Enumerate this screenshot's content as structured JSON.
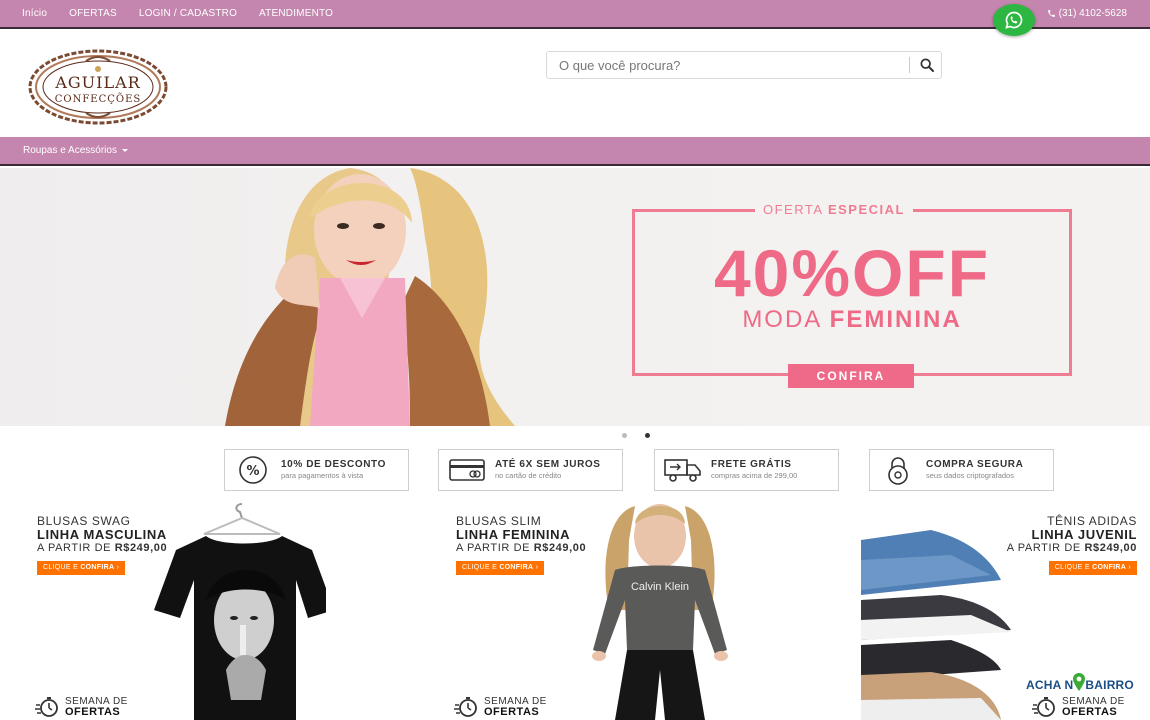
{
  "topbar": {
    "nav": [
      "Início",
      "OFERTAS",
      "LOGIN / CADASTRO",
      "ATENDIMENTO"
    ],
    "phone": "(31) 4102-5628",
    "phone_icon": "phone-icon",
    "whatsapp_icon": "whatsapp-icon"
  },
  "header": {
    "logo_line1": "AGUILAR",
    "logo_line2": "CONFECÇÕES",
    "search_placeholder": "O que você procura?",
    "search_icon": "search-icon"
  },
  "category_menu": {
    "label": "Roupas e Acessórios"
  },
  "banner": {
    "tag_light": "OFERTA",
    "tag_bold": "ESPECIAL",
    "headline": "40%OFF",
    "sub_light": "MODA",
    "sub_bold": "FEMININA",
    "cta": "CONFIRA",
    "slides_total": 2,
    "active_slide": 2
  },
  "features": [
    {
      "title": "10% DE DESCONTO",
      "subtitle": "para pagamentos à vista",
      "icon": "percent-icon"
    },
    {
      "title": "ATÉ 6X SEM JUROS",
      "subtitle": "no cartão de crédito",
      "icon": "credit-card-icon"
    },
    {
      "title": "FRETE GRÁTIS",
      "subtitle": "compras acima de 299,00",
      "icon": "truck-icon"
    },
    {
      "title": "COMPRA SEGURA",
      "subtitle": "seus dados criptografados",
      "icon": "lock-icon"
    }
  ],
  "products": [
    {
      "line1": "BLUSAS SWAG",
      "line2": "LINHA MASCULINA",
      "price_prefix": "A PARTIR DE",
      "price": "R$249,00",
      "cta_light": "CLIQUE E",
      "cta_bold": "CONFIRA",
      "week_line1": "SEMANA DE",
      "week_line2": "OFERTAS"
    },
    {
      "line1": "BLUSAS SLIM",
      "line2": "LINHA FEMININA",
      "price_prefix": "A PARTIR DE",
      "price": "R$249,00",
      "cta_light": "CLIQUE E",
      "cta_bold": "CONFIRA",
      "week_line1": "SEMANA DE",
      "week_line2": "OFERTAS",
      "shirt_text": "Calvin Klein"
    },
    {
      "line1": "TÊNIS ADIDAS",
      "line2": "LINHA JUVENIL",
      "price_prefix": "A PARTIR DE",
      "price": "R$249,00",
      "cta_light": "CLIQUE E",
      "cta_bold": "CONFIRA",
      "week_line1": "SEMANA DE",
      "week_line2": "OFERTAS"
    }
  ],
  "watermark": {
    "left": "ACHA N",
    "right": "BAIRRO"
  },
  "colors": {
    "bar": "#c486ae",
    "accent_pink": "#ee6a86",
    "cta_orange": "#ff7200",
    "whatsapp": "#2db742"
  }
}
